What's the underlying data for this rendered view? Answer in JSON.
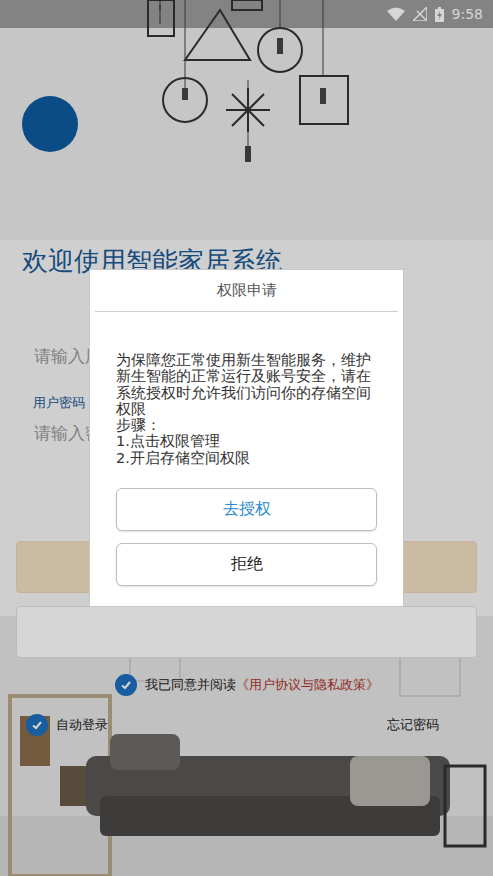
{
  "status_bar": {
    "time": "9:58"
  },
  "title": "欢迎使用智能家居系统",
  "form": {
    "username_placeholder": "请输入用",
    "password_label": "用户密码",
    "password_placeholder": "请输入密"
  },
  "agreement": {
    "text": "我已同意并阅读",
    "link": "《用户协议与隐私政策》",
    "checked": true
  },
  "auto_login": {
    "label": "自动登录",
    "checked": true
  },
  "forgot_password": "忘记密码",
  "dialog": {
    "title": "权限申请",
    "message": "为保障您正常使用新生智能服务，维护新生智能的正常运行及账号安全，请在系统授权时允许我们访问你的存储空间权限",
    "steps_title": "步骤：",
    "steps": [
      "1.点击权限管理",
      "2.开启存储空间权限"
    ],
    "buttons": [
      {
        "label": "去授权",
        "primary": true
      },
      {
        "label": "拒绝",
        "primary": false
      }
    ]
  }
}
